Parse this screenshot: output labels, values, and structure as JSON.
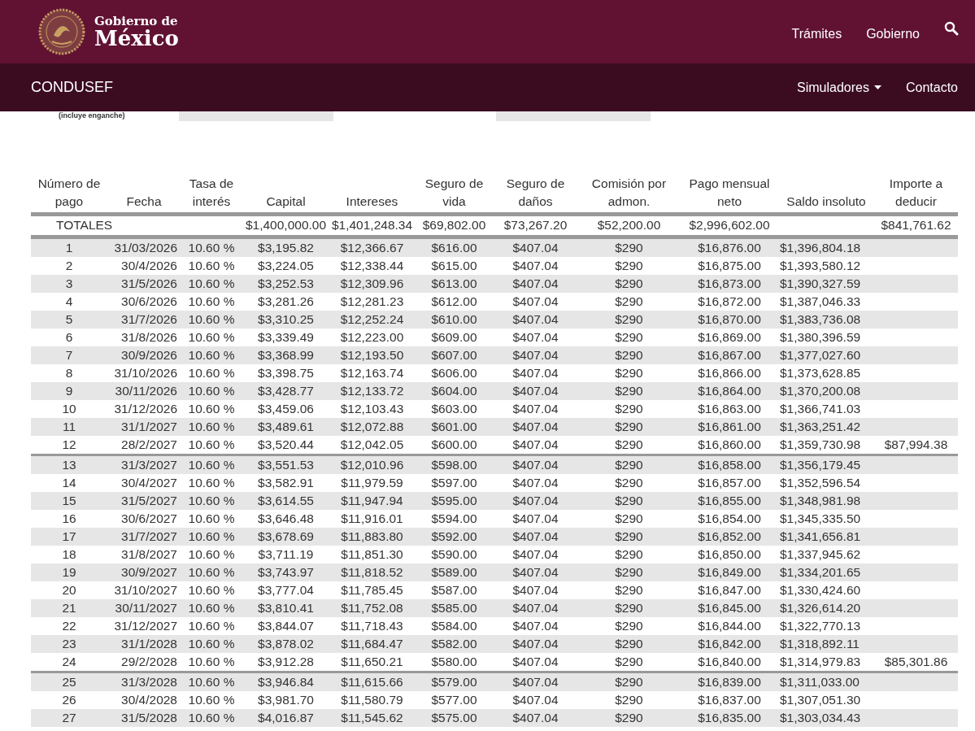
{
  "header": {
    "brand_line_1": "Gobierno de",
    "brand_line_2": "México",
    "nav": [
      "Trámites",
      "Gobierno"
    ]
  },
  "subnav": {
    "title": "CONDUSEF",
    "menu": [
      {
        "label": "Simuladores",
        "dropdown": true
      },
      {
        "label": "Contacto",
        "dropdown": false
      }
    ]
  },
  "form_fragment": {
    "note": "(incluye enganche)"
  },
  "table": {
    "columns": [
      "Número de pago",
      "Fecha",
      "Tasa de interés",
      "Capital",
      "Intereses",
      "Seguro de vida",
      "Seguro de daños",
      "Comisión por admon.",
      "Pago mensual neto",
      "Saldo insoluto",
      "Importe a deducir"
    ],
    "totals": {
      "label": "TOTALES",
      "capital": "$1,400,000.00",
      "intereses": "$1,401,248.34",
      "seguro_vida": "$69,802.00",
      "seguro_danos": "$73,267.20",
      "comision": "$52,200.00",
      "pago": "$2,996,602.00",
      "importe": "$841,761.62"
    },
    "rows": [
      {
        "year_end": false,
        "cells": [
          "1",
          "31/03/2026",
          "10.60 %",
          "$3,195.82",
          "$12,366.67",
          "$616.00",
          "$407.04",
          "$290",
          "$16,876.00",
          "$1,396,804.18"
        ]
      },
      {
        "year_end": false,
        "cells": [
          "2",
          "30/4/2026",
          "10.60 %",
          "$3,224.05",
          "$12,338.44",
          "$615.00",
          "$407.04",
          "$290",
          "$16,875.00",
          "$1,393,580.12"
        ]
      },
      {
        "year_end": false,
        "cells": [
          "3",
          "31/5/2026",
          "10.60 %",
          "$3,252.53",
          "$12,309.96",
          "$613.00",
          "$407.04",
          "$290",
          "$16,873.00",
          "$1,390,327.59"
        ]
      },
      {
        "year_end": false,
        "cells": [
          "4",
          "30/6/2026",
          "10.60 %",
          "$3,281.26",
          "$12,281.23",
          "$612.00",
          "$407.04",
          "$290",
          "$16,872.00",
          "$1,387,046.33"
        ]
      },
      {
        "year_end": false,
        "cells": [
          "5",
          "31/7/2026",
          "10.60 %",
          "$3,310.25",
          "$12,252.24",
          "$610.00",
          "$407.04",
          "$290",
          "$16,870.00",
          "$1,383,736.08"
        ]
      },
      {
        "year_end": false,
        "cells": [
          "6",
          "31/8/2026",
          "10.60 %",
          "$3,339.49",
          "$12,223.00",
          "$609.00",
          "$407.04",
          "$290",
          "$16,869.00",
          "$1,380,396.59"
        ]
      },
      {
        "year_end": false,
        "cells": [
          "7",
          "30/9/2026",
          "10.60 %",
          "$3,368.99",
          "$12,193.50",
          "$607.00",
          "$407.04",
          "$290",
          "$16,867.00",
          "$1,377,027.60"
        ]
      },
      {
        "year_end": false,
        "cells": [
          "8",
          "31/10/2026",
          "10.60 %",
          "$3,398.75",
          "$12,163.74",
          "$606.00",
          "$407.04",
          "$290",
          "$16,866.00",
          "$1,373,628.85"
        ]
      },
      {
        "year_end": false,
        "cells": [
          "9",
          "30/11/2026",
          "10.60 %",
          "$3,428.77",
          "$12,133.72",
          "$604.00",
          "$407.04",
          "$290",
          "$16,864.00",
          "$1,370,200.08"
        ]
      },
      {
        "year_end": false,
        "cells": [
          "10",
          "31/12/2026",
          "10.60 %",
          "$3,459.06",
          "$12,103.43",
          "$603.00",
          "$407.04",
          "$290",
          "$16,863.00",
          "$1,366,741.03"
        ]
      },
      {
        "year_end": false,
        "cells": [
          "11",
          "31/1/2027",
          "10.60 %",
          "$3,489.61",
          "$12,072.88",
          "$601.00",
          "$407.04",
          "$290",
          "$16,861.00",
          "$1,363,251.42"
        ]
      },
      {
        "year_end": true,
        "cells": [
          "12",
          "28/2/2027",
          "10.60 %",
          "$3,520.44",
          "$12,042.05",
          "$600.00",
          "$407.04",
          "$290",
          "$16,860.00",
          "$1,359,730.98",
          "$87,994.38"
        ]
      },
      {
        "year_end": false,
        "cells": [
          "13",
          "31/3/2027",
          "10.60 %",
          "$3,551.53",
          "$12,010.96",
          "$598.00",
          "$407.04",
          "$290",
          "$16,858.00",
          "$1,356,179.45"
        ]
      },
      {
        "year_end": false,
        "cells": [
          "14",
          "30/4/2027",
          "10.60 %",
          "$3,582.91",
          "$11,979.59",
          "$597.00",
          "$407.04",
          "$290",
          "$16,857.00",
          "$1,352,596.54"
        ]
      },
      {
        "year_end": false,
        "cells": [
          "15",
          "31/5/2027",
          "10.60 %",
          "$3,614.55",
          "$11,947.94",
          "$595.00",
          "$407.04",
          "$290",
          "$16,855.00",
          "$1,348,981.98"
        ]
      },
      {
        "year_end": false,
        "cells": [
          "16",
          "30/6/2027",
          "10.60 %",
          "$3,646.48",
          "$11,916.01",
          "$594.00",
          "$407.04",
          "$290",
          "$16,854.00",
          "$1,345,335.50"
        ]
      },
      {
        "year_end": false,
        "cells": [
          "17",
          "31/7/2027",
          "10.60 %",
          "$3,678.69",
          "$11,883.80",
          "$592.00",
          "$407.04",
          "$290",
          "$16,852.00",
          "$1,341,656.81"
        ]
      },
      {
        "year_end": false,
        "cells": [
          "18",
          "31/8/2027",
          "10.60 %",
          "$3,711.19",
          "$11,851.30",
          "$590.00",
          "$407.04",
          "$290",
          "$16,850.00",
          "$1,337,945.62"
        ]
      },
      {
        "year_end": false,
        "cells": [
          "19",
          "30/9/2027",
          "10.60 %",
          "$3,743.97",
          "$11,818.52",
          "$589.00",
          "$407.04",
          "$290",
          "$16,849.00",
          "$1,334,201.65"
        ]
      },
      {
        "year_end": false,
        "cells": [
          "20",
          "31/10/2027",
          "10.60 %",
          "$3,777.04",
          "$11,785.45",
          "$587.00",
          "$407.04",
          "$290",
          "$16,847.00",
          "$1,330,424.60"
        ]
      },
      {
        "year_end": false,
        "cells": [
          "21",
          "30/11/2027",
          "10.60 %",
          "$3,810.41",
          "$11,752.08",
          "$585.00",
          "$407.04",
          "$290",
          "$16,845.00",
          "$1,326,614.20"
        ]
      },
      {
        "year_end": false,
        "cells": [
          "22",
          "31/12/2027",
          "10.60 %",
          "$3,844.07",
          "$11,718.43",
          "$584.00",
          "$407.04",
          "$290",
          "$16,844.00",
          "$1,322,770.13"
        ]
      },
      {
        "year_end": false,
        "cells": [
          "23",
          "31/1/2028",
          "10.60 %",
          "$3,878.02",
          "$11,684.47",
          "$582.00",
          "$407.04",
          "$290",
          "$16,842.00",
          "$1,318,892.11"
        ]
      },
      {
        "year_end": true,
        "cells": [
          "24",
          "29/2/2028",
          "10.60 %",
          "$3,912.28",
          "$11,650.21",
          "$580.00",
          "$407.04",
          "$290",
          "$16,840.00",
          "$1,314,979.83",
          "$85,301.86"
        ]
      },
      {
        "year_end": false,
        "cells": [
          "25",
          "31/3/2028",
          "10.60 %",
          "$3,946.84",
          "$11,615.66",
          "$579.00",
          "$407.04",
          "$290",
          "$16,839.00",
          "$1,311,033.00"
        ]
      },
      {
        "year_end": false,
        "cells": [
          "26",
          "30/4/2028",
          "10.60 %",
          "$3,981.70",
          "$11,580.79",
          "$577.00",
          "$407.04",
          "$290",
          "$16,837.00",
          "$1,307,051.30"
        ]
      },
      {
        "year_end": false,
        "cells": [
          "27",
          "31/5/2028",
          "10.60 %",
          "$4,016.87",
          "$11,545.62",
          "$575.00",
          "$407.04",
          "$290",
          "$16,835.00",
          "$1,303,034.43"
        ]
      }
    ]
  }
}
